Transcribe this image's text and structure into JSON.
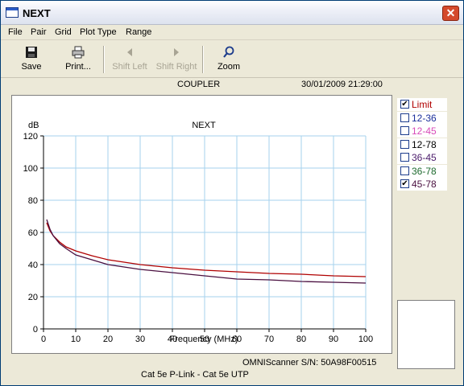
{
  "window": {
    "title": "NEXT",
    "close_label": "✕"
  },
  "menu": [
    "File",
    "Pair",
    "Grid",
    "Plot Type",
    "Range"
  ],
  "toolbar": {
    "save": "Save",
    "print": "Print...",
    "shift_left": "Shift Left",
    "shift_right": "Shift Right",
    "zoom": "Zoom"
  },
  "header": {
    "test_name": "COUPLER",
    "datetime": "30/01/2009 21:29:00"
  },
  "footer": {
    "device": "OMNIScanner  S/N: 50A98F00515",
    "cable": "Cat 5e P-Link - Cat 5e UTP"
  },
  "legend": [
    {
      "label": "Limit",
      "checked": true,
      "color": "#b00000"
    },
    {
      "label": "12-36",
      "checked": false,
      "color": "#1a2e9a"
    },
    {
      "label": "12-45",
      "checked": false,
      "color": "#d84ab8"
    },
    {
      "label": "12-78",
      "checked": false,
      "color": "#000000"
    },
    {
      "label": "36-45",
      "checked": false,
      "color": "#4a1a6a"
    },
    {
      "label": "36-78",
      "checked": false,
      "color": "#1e6a2e"
    },
    {
      "label": "45-78",
      "checked": true,
      "color": "#4a1040"
    }
  ],
  "chart_data": {
    "type": "line",
    "title": "NEXT",
    "xlabel": "Frequency (MHz)",
    "ylabel": "dB",
    "xlim": [
      0,
      100
    ],
    "ylim": [
      0,
      120
    ],
    "xticks": [
      0,
      10,
      20,
      30,
      40,
      50,
      60,
      70,
      80,
      90,
      100
    ],
    "yticks": [
      0,
      20,
      40,
      60,
      80,
      100,
      120
    ],
    "grid": true,
    "series": [
      {
        "name": "Limit",
        "color": "#b00000",
        "x": [
          1,
          2,
          3,
          5,
          7,
          10,
          15,
          20,
          25,
          30,
          40,
          50,
          60,
          70,
          80,
          90,
          100
        ],
        "y": [
          66,
          61,
          58,
          54,
          51,
          48.5,
          45.5,
          43,
          41.5,
          40,
          38,
          36.5,
          35.5,
          34.5,
          34,
          33,
          32.5
        ]
      },
      {
        "name": "45-78",
        "color": "#4a1040",
        "x": [
          1,
          2,
          3,
          5,
          7,
          10,
          15,
          20,
          25,
          30,
          40,
          50,
          60,
          70,
          80,
          90,
          100
        ],
        "y": [
          68,
          62,
          58,
          53,
          50,
          46,
          43,
          40,
          38.5,
          37,
          35,
          33,
          31,
          30.5,
          29.5,
          29,
          28.5
        ]
      }
    ]
  }
}
